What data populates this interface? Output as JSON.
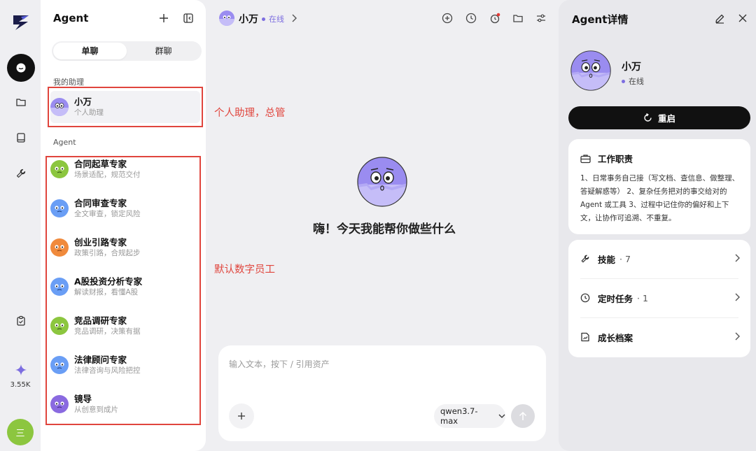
{
  "rail": {
    "count": "3.55K",
    "avatar_letter": "三",
    "icons": [
      "chat-icon",
      "folder-icon",
      "book-icon",
      "wrench-icon",
      "clipboard-icon",
      "sparkle-icon"
    ]
  },
  "sidebar": {
    "title": "Agent",
    "tabs": [
      {
        "label": "单聊"
      },
      {
        "label": "群聊"
      }
    ],
    "my_assistant_label": "我的助理",
    "assistant": {
      "name": "小万",
      "subtitle": "个人助理"
    },
    "agents_label": "Agent",
    "agents": [
      {
        "name": "合同起草专家",
        "subtitle": "场景适配，规范交付"
      },
      {
        "name": "合同审查专家",
        "subtitle": "全文审查，锁定风险"
      },
      {
        "name": "创业引路专家",
        "subtitle": "政策引路，合规起步"
      },
      {
        "name": "A股投资分析专家",
        "subtitle": "解读财报，看懂A股"
      },
      {
        "name": "竞品调研专家",
        "subtitle": "竞品调研，决策有据"
      },
      {
        "name": "法律顾问专家",
        "subtitle": "法律咨询与风险把控"
      },
      {
        "name": "镜导",
        "subtitle": "从创意到成片"
      }
    ]
  },
  "annotations": {
    "assistant_note": "个人助理，总管",
    "agents_note": "默认数字员工"
  },
  "main": {
    "name": "小万",
    "status": "在线",
    "greeting": "嗨！今天我能帮你做些什么",
    "input_placeholder": "输入文本，按下 / 引用资产",
    "model": "qwen3.7-max"
  },
  "detail": {
    "title": "Agent详情",
    "name": "小万",
    "status": "在线",
    "restart_label": "重启",
    "duty_title": "工作职责",
    "duty_text": "1、日常事务自己接（写文档、查信息、做整理、答疑解惑等） 2、复杂任务把对的事交给对的 Agent 或工具 3、过程中记住你的偏好和上下文，让协作可追溯、不重复。",
    "rows": [
      {
        "label": "技能",
        "count": "· 7"
      },
      {
        "label": "定时任务",
        "count": "· 1"
      },
      {
        "label": "成长档案",
        "count": ""
      }
    ]
  },
  "colors": {
    "accent": "#7c6de0",
    "annotation": "#e0453d",
    "mascot_body": "#9a8cf0"
  }
}
